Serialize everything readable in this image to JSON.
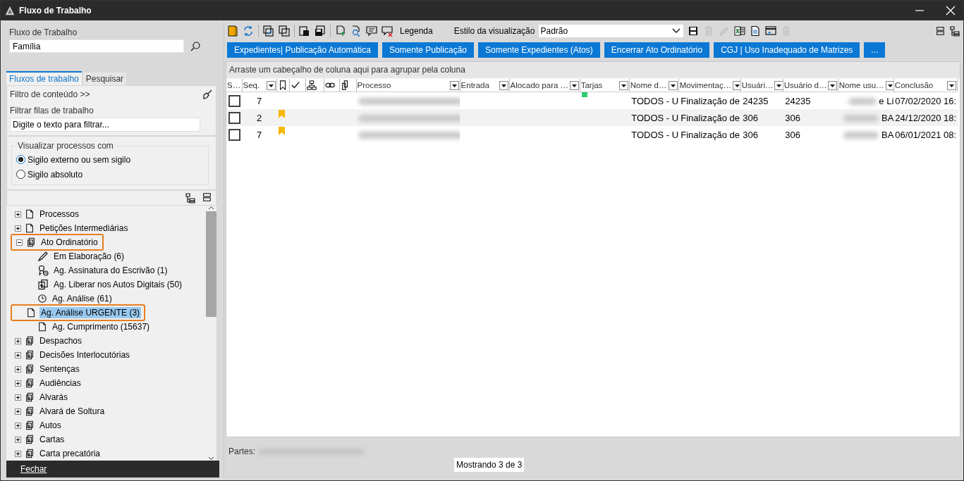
{
  "window": {
    "title": "Fluxo de Trabalho"
  },
  "sidebar": {
    "workflow_label": "Fluxo de Trabalho",
    "workflow_value": "Família",
    "tabs": [
      {
        "label": "Fluxos de trabalho",
        "selected": true
      },
      {
        "label": "Pesquisar",
        "selected": false
      }
    ],
    "content_filter": "Filtro de conteúdo >>",
    "filter_label": "Filtrar filas de trabalho",
    "filter_placeholder": "Digite o texto para filtrar...",
    "visibility": {
      "legend": "Visualizar processos com",
      "options": [
        {
          "label": "Sigilo externo ou sem sigilo",
          "selected": true
        },
        {
          "label": "Sigilo absoluto",
          "selected": false
        }
      ]
    },
    "tree": [
      {
        "label": "Processos",
        "kind": "doc",
        "expanded": false,
        "selected": false,
        "highlighted": false
      },
      {
        "label": "Petições Intermediárias",
        "kind": "doc",
        "expanded": false,
        "selected": false,
        "highlighted": false
      },
      {
        "label": "Ato Ordinatório",
        "kind": "stack",
        "expanded": true,
        "selected": false,
        "highlighted": true,
        "children": [
          {
            "label": "Em Elaboração (6)",
            "kind": "pen",
            "selected": false,
            "highlighted": false
          },
          {
            "label": "Ag. Assinatura do Escrivão (1)",
            "kind": "seal",
            "selected": false,
            "highlighted": false
          },
          {
            "label": "Ag. Liberar nos Autos Digitais (50)",
            "kind": "upload",
            "selected": false,
            "highlighted": false
          },
          {
            "label": "Ag. Análise (61)",
            "kind": "clock",
            "selected": false,
            "highlighted": false
          },
          {
            "label": "Ag. Análise URGENTE (3)",
            "kind": "doc",
            "selected": true,
            "highlighted": true
          },
          {
            "label": "Ag. Cumprimento (15637)",
            "kind": "doc",
            "selected": false,
            "highlighted": false
          }
        ]
      },
      {
        "label": "Despachos",
        "kind": "stack",
        "expanded": false,
        "selected": false,
        "highlighted": false
      },
      {
        "label": "Decisões Interlocutórias",
        "kind": "stack",
        "expanded": false,
        "selected": false,
        "highlighted": false
      },
      {
        "label": "Sentenças",
        "kind": "stack",
        "expanded": false,
        "selected": false,
        "highlighted": false
      },
      {
        "label": "Audiências",
        "kind": "stack",
        "expanded": false,
        "selected": false,
        "highlighted": false
      },
      {
        "label": "Alvarás",
        "kind": "stack",
        "expanded": false,
        "selected": false,
        "highlighted": false
      },
      {
        "label": "Alvará de Soltura",
        "kind": "stack",
        "expanded": false,
        "selected": false,
        "highlighted": false
      },
      {
        "label": "Autos",
        "kind": "stack",
        "expanded": false,
        "selected": false,
        "highlighted": false
      },
      {
        "label": "Cartas",
        "kind": "stack",
        "expanded": false,
        "selected": false,
        "highlighted": false
      },
      {
        "label": "Carta precatória",
        "kind": "stack",
        "expanded": false,
        "selected": false,
        "highlighted": false
      }
    ],
    "close_button": "Fechar"
  },
  "toolbar": {
    "legend": "Legenda",
    "view_style_label": "Estilo da visualização",
    "view_style_value": "Padrão",
    "tools": [
      {
        "kind": "save",
        "disabled": false
      },
      {
        "kind": "trash",
        "disabled": true
      },
      {
        "kind": "pencil",
        "disabled": true
      },
      {
        "kind": "sheet",
        "disabled": false
      },
      {
        "kind": "doc",
        "disabled": false
      },
      {
        "kind": "window",
        "disabled": false
      },
      {
        "kind": "trash",
        "disabled": true
      }
    ]
  },
  "filter_buttons": [
    "Expedientes| Publicação Automática",
    "Somente Publicação",
    "Somente Expedientes  (Atos)",
    "Encerrar Ato Ordinatório",
    "CGJ | Uso Inadequado de Matrizes",
    "..."
  ],
  "grid": {
    "group_hint": "Arraste um cabeçalho de coluna aqui para agrupar pela coluna",
    "columns": [
      {
        "kind": "text",
        "label": "S…",
        "filter": false
      },
      {
        "kind": "text",
        "label": "Seq.",
        "filter": true
      },
      {
        "kind": "bookmark",
        "filter": false
      },
      {
        "kind": "check",
        "filter": false
      },
      {
        "kind": "flow",
        "filter": false
      },
      {
        "kind": "link",
        "filter": false
      },
      {
        "kind": "docs",
        "filter": false
      },
      {
        "kind": "text",
        "label": "Processo",
        "filter": true
      },
      {
        "kind": "text",
        "label": "Entrada",
        "filter": true
      },
      {
        "kind": "text",
        "label": "Alocado para …",
        "filter": true
      },
      {
        "kind": "text",
        "label": "Tarjas",
        "filter": true
      },
      {
        "kind": "text",
        "label": "Nome d…",
        "filter": true
      },
      {
        "kind": "text",
        "label": "Movimentaç…",
        "filter": true
      },
      {
        "kind": "text",
        "label": "Usuári…",
        "filter": true
      },
      {
        "kind": "text",
        "label": "Usuário d…",
        "filter": true
      },
      {
        "kind": "text",
        "label": "Nome usu…",
        "filter": true
      },
      {
        "kind": "text",
        "label": "Conclusão",
        "filter": true
      }
    ],
    "rows": [
      {
        "checked": false,
        "seq": "7",
        "bookmark": false,
        "color": "#2ecc71",
        "nome": "TODOS - U",
        "movimentacao": "Finalização de",
        "usuario": "24235",
        "usuario_d": "24235",
        "nome_usuario": "e Li",
        "conclusao": "07/02/2020 16:"
      },
      {
        "checked": false,
        "seq": "2",
        "bookmark": true,
        "nome": "TODOS - U",
        "movimentacao": "Finalização de",
        "usuario": "306",
        "usuario_d": "306",
        "nome_usuario": "BA",
        "conclusao": "24/12/2020 18:"
      },
      {
        "checked": false,
        "seq": "7",
        "bookmark": true,
        "nome": "TODOS - U",
        "movimentacao": "Finalização de",
        "usuario": "306",
        "usuario_d": "306",
        "nome_usuario": "BA",
        "conclusao": "06/01/2021 08:"
      }
    ]
  },
  "status_bar": {
    "parts_label": "Partes:",
    "count": "Mostrando 3 de 3"
  }
}
